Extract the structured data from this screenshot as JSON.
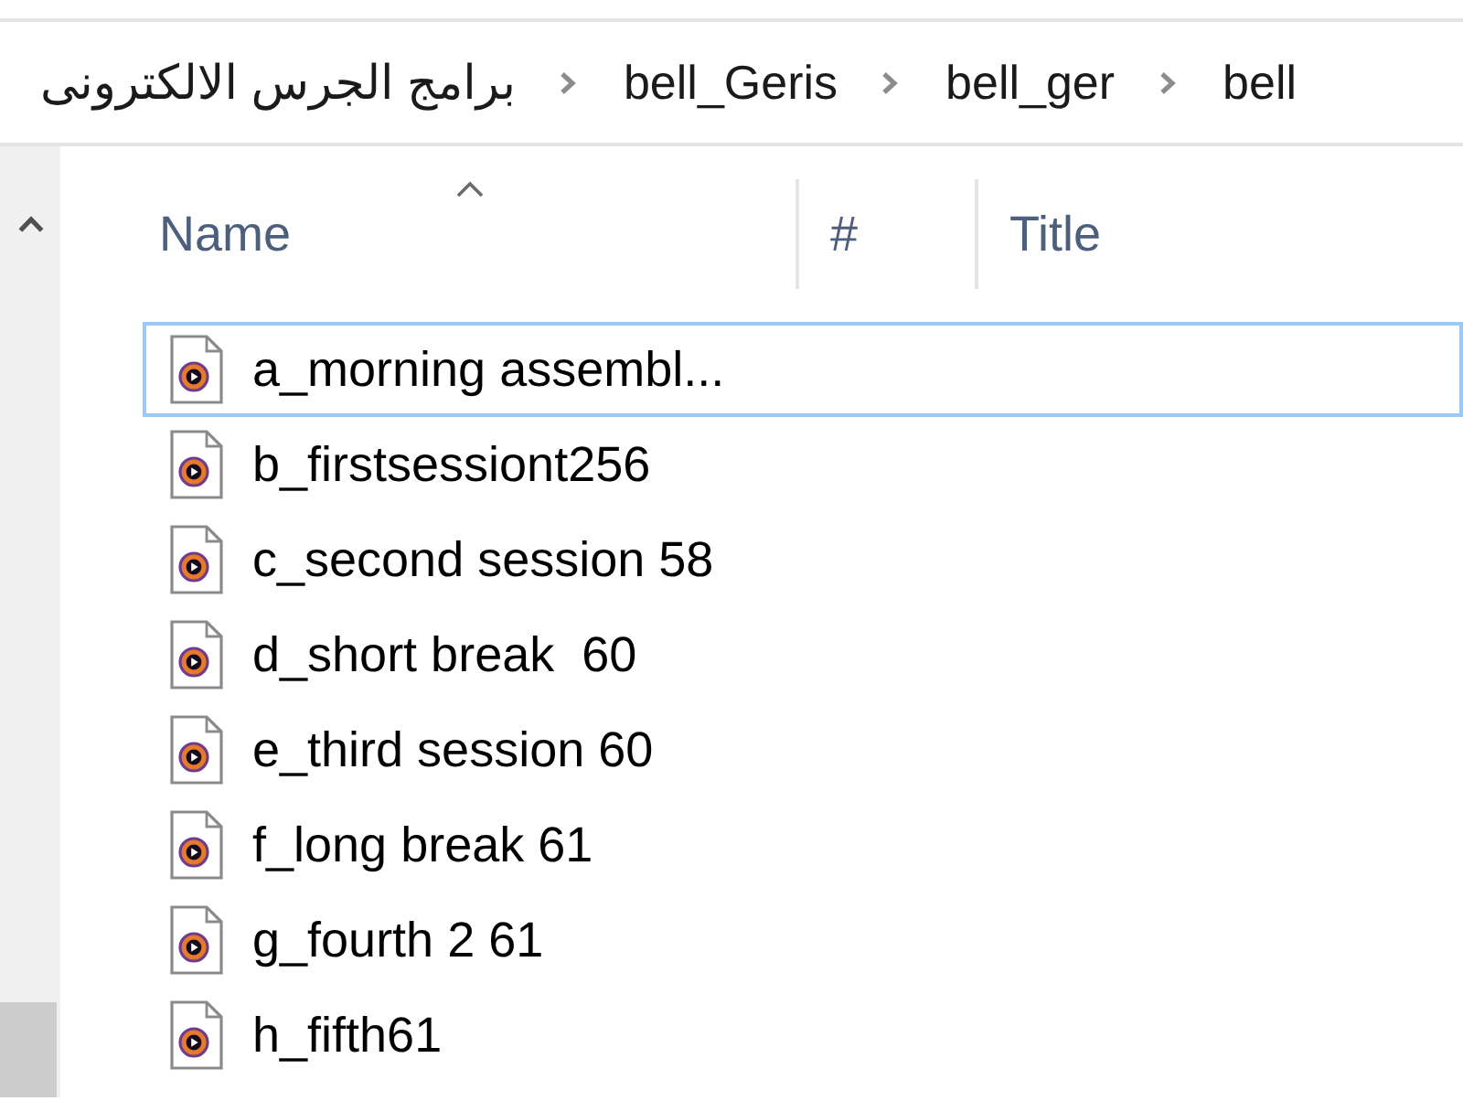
{
  "breadcrumb": {
    "items": [
      {
        "label": "برامج الجرس الالكترونى"
      },
      {
        "label": "bell_Geris"
      },
      {
        "label": "bell_ger"
      },
      {
        "label": "bell"
      }
    ]
  },
  "file_list": {
    "columns": [
      {
        "label": "Name",
        "sorted": true
      },
      {
        "label": "#",
        "sorted": false
      },
      {
        "label": "Title",
        "sorted": false
      }
    ],
    "rows": [
      {
        "name": "a_morning assembl...",
        "focused": true
      },
      {
        "name": "b_firstsessiont256",
        "focused": false
      },
      {
        "name": "c_second session 58",
        "focused": false
      },
      {
        "name": "d_short break  60",
        "focused": false
      },
      {
        "name": "e_third session 60",
        "focused": false
      },
      {
        "name": "f_long break 61",
        "focused": false
      },
      {
        "name": "g_fourth 2 61",
        "focused": false
      },
      {
        "name": "h_fifth61",
        "focused": false
      }
    ]
  }
}
